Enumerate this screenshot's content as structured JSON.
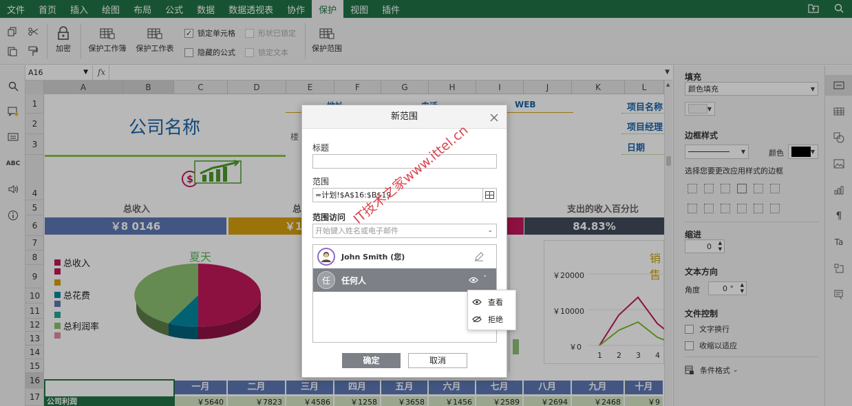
{
  "menu": {
    "items": [
      "文件",
      "首页",
      "插入",
      "绘图",
      "布局",
      "公式",
      "数据",
      "数据透视表",
      "协作",
      "保护",
      "视图",
      "插件"
    ],
    "active": "保护"
  },
  "ribbon": {
    "encrypt": "加密",
    "protect_workbook": "保护工作簿",
    "protect_sheet": "保护工作表",
    "lock_cell": "锁定单元格",
    "hidden_formula": "隐藏的公式",
    "shape_locked": "形状已锁定",
    "lock_text": "锁定文本",
    "protect_range": "保护范围"
  },
  "formula_bar": {
    "name_box": "A16",
    "fx": "fx"
  },
  "sheet": {
    "columns": [
      "A",
      "B",
      "C",
      "D",
      "E",
      "F",
      "G",
      "H",
      "I",
      "J",
      "K",
      "L"
    ],
    "rows": [
      "1",
      "2",
      "3",
      "4",
      "5",
      "6",
      "7",
      "8",
      "9",
      "10",
      "11",
      "12",
      "13",
      "14",
      "15",
      "16",
      "17"
    ],
    "company": "公司名称",
    "top_texts": [
      "地址",
      "电话",
      "WEB",
      "楼"
    ],
    "right_labels": [
      "项目名称",
      "项目经理",
      "日期"
    ],
    "kpi_labels": [
      "总收入",
      "总",
      "支出的收入百分比"
    ],
    "kpi_values": [
      "￥8 0146",
      "￥1",
      "84.83%"
    ],
    "legend": [
      "总收入",
      "总花费",
      "总利润率"
    ],
    "chart_title_summer": "夏天",
    "chart_title_sales": "销售",
    "y_ticks": [
      "￥20000",
      "￥10000",
      "￥0"
    ],
    "x_ticks": [
      "1",
      "2",
      "3",
      "4"
    ],
    "months": [
      "一月",
      "二月",
      "三月",
      "四月",
      "五月",
      "六月",
      "七月",
      "八月",
      "九月",
      "十月"
    ],
    "row17_label": "公司利润",
    "row17_values": [
      "￥5640",
      "￥7823",
      "￥4586",
      "￥1258",
      "￥3658",
      "￥1456",
      "￥2589",
      "￥2694",
      "￥2468",
      "￥9"
    ]
  },
  "right_panel": {
    "fill_title": "填充",
    "fill_type": "颜色填充",
    "border_style_title": "边框样式",
    "color_label": "颜色",
    "border_hint": "选择您要更改应用样式的边框",
    "indent_title": "缩进",
    "indent_value": "0",
    "text_direction_title": "文本方向",
    "angle_label": "角度",
    "angle_value": "0 °",
    "text_control_title": "文件控制",
    "wrap_text": "文字换行",
    "shrink_fit": "收缩以适应",
    "conditional_format": "条件格式"
  },
  "dialog": {
    "title": "新范围",
    "title_label": "标题",
    "title_value": "",
    "range_label": "范围",
    "range_value": "=计划!$A$16:$B$19",
    "access_label": "范围访问",
    "access_placeholder": "开始键入姓名或电子邮件",
    "users": [
      {
        "name": "John Smith (您)"
      },
      {
        "name": "任何人",
        "avatar": "任"
      }
    ],
    "ok": "确定",
    "cancel": "取消"
  },
  "popup": {
    "view": "查看",
    "deny": "拒绝"
  },
  "watermark": "IT技术之家www.ittel.cn",
  "colors": {
    "green": "#217346",
    "kpi_blue": "#5e78b5",
    "kpi_gold": "#d7a010",
    "kpi_dark": "#424b5a",
    "pink": "#c2185b",
    "teal": "#0288a0",
    "light_green": "#8cbf72"
  }
}
